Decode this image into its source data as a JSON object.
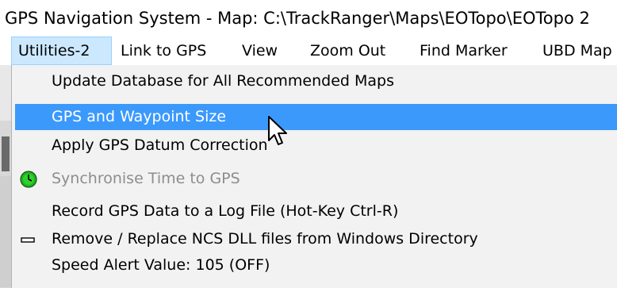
{
  "window": {
    "title": "GPS Navigation System - Map: C:\\TrackRanger\\Maps\\EOTopo\\EOTopo 2"
  },
  "menubar": {
    "items": [
      {
        "label": "Utilities-2",
        "active": true
      },
      {
        "label": "Link to GPS"
      },
      {
        "label": "View"
      },
      {
        "label": "Zoom Out"
      },
      {
        "label": "Find Marker"
      },
      {
        "label": "UBD Map"
      }
    ]
  },
  "dropdown": {
    "items": [
      {
        "label": "Update Database for All Recommended Maps",
        "icon": null,
        "state": "normal"
      },
      {
        "label": "GPS and Waypoint Size",
        "icon": null,
        "state": "highlighted"
      },
      {
        "label": "Apply GPS Datum Correction",
        "icon": null,
        "state": "normal"
      },
      {
        "label": "Synchronise Time to GPS",
        "icon": "clock-icon",
        "state": "disabled"
      },
      {
        "label": "Record GPS Data to a Log File (Hot-Key Ctrl-R)",
        "icon": null,
        "state": "normal"
      },
      {
        "label": "Remove / Replace NCS DLL files from Windows Directory",
        "icon": "dash-icon",
        "state": "normal"
      },
      {
        "label": "Speed Alert Value: 105 (OFF)",
        "icon": null,
        "state": "normal"
      }
    ]
  },
  "colors": {
    "highlight": "#3b99fc",
    "menubar_active": "#cce8ff",
    "menu_background": "#f2f2f2",
    "disabled_text": "#8d8d8d",
    "clock_green": "#22b022"
  }
}
